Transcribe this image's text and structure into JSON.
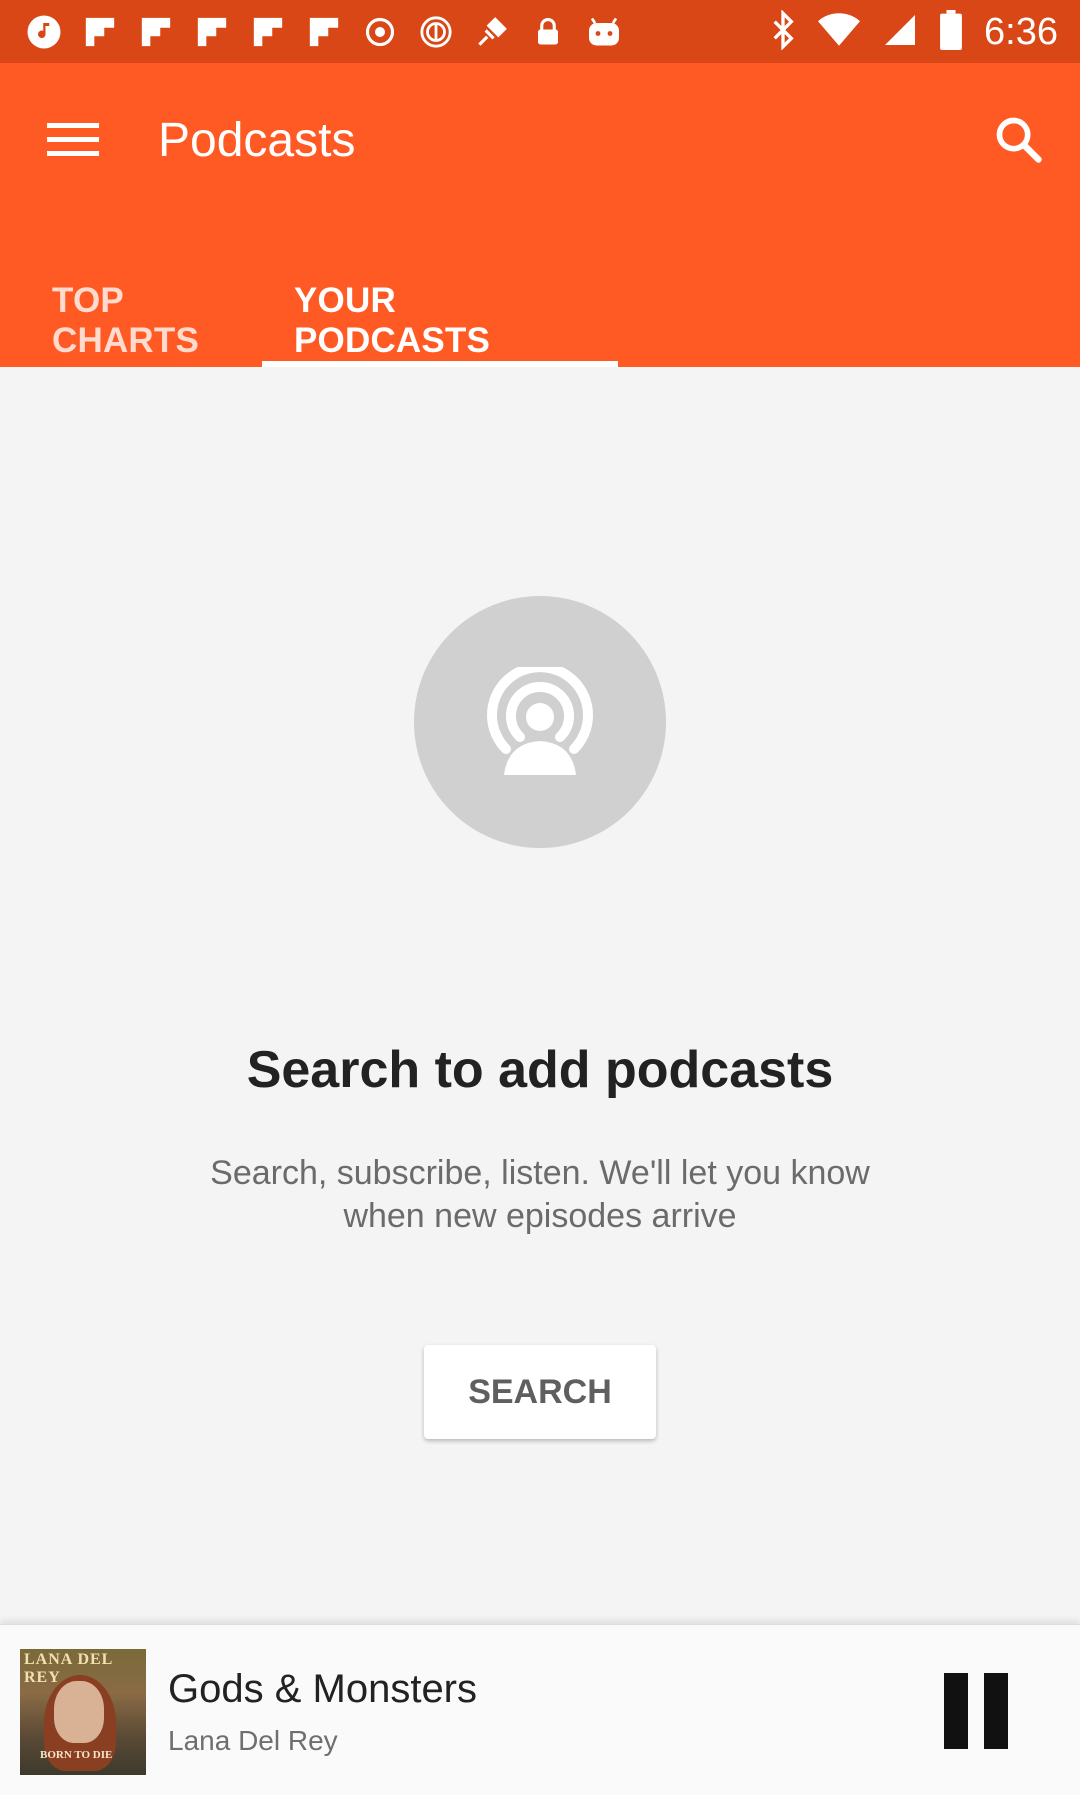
{
  "status_bar": {
    "time": "6:36",
    "left_icons": [
      "music-note-icon",
      "flipboard-icon",
      "flipboard-icon",
      "flipboard-icon",
      "flipboard-icon",
      "flipboard-icon",
      "radio-icon",
      "record-icon",
      "fake-gps-icon",
      "lock-icon",
      "android-icon"
    ],
    "right_icons": [
      "bluetooth-icon",
      "wifi-icon",
      "signal-icon",
      "battery-icon"
    ]
  },
  "app_bar": {
    "title": "Podcasts",
    "background": "#ff5a24"
  },
  "tabs": [
    {
      "label": "TOP CHARTS",
      "active": false
    },
    {
      "label": "YOUR PODCASTS",
      "active": true
    }
  ],
  "empty_state": {
    "icon": "podcast-icon",
    "title": "Search to add podcasts",
    "subtitle": "Search, subscribe, listen. We'll let you know when new episodes arrive",
    "button_label": "SEARCH"
  },
  "now_playing": {
    "track_title": "Gods & Monsters",
    "artist": "Lana Del Rey",
    "cover_text": "LANA DEL REY",
    "cover_subtext": "BORN TO DIE",
    "state": "playing"
  }
}
